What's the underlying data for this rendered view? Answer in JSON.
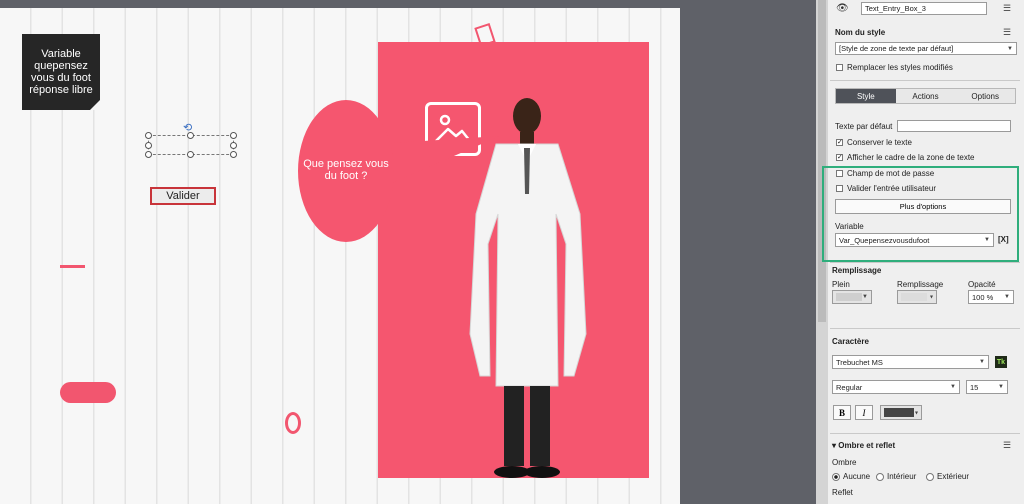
{
  "stage": {
    "note_text": "Variable quepensez vous du foot réponse libre",
    "validate_button": "Valider",
    "bubble_text": "Que pensez vous du foot ?"
  },
  "panel": {
    "object_name": "Text_Entry_Box_3",
    "style_name_label": "Nom du style",
    "style_name_value": "[Style de zone de texte par défaut]",
    "replace_styles_label": "Remplacer les styles modifiés",
    "tabs": [
      {
        "label": "Style",
        "active": true
      },
      {
        "label": "Actions",
        "active": false
      },
      {
        "label": "Options",
        "active": false
      }
    ],
    "default_text_label": "Texte par défaut",
    "default_text_value": "",
    "keep_text_label": "Conserver le texte",
    "keep_text_checked": true,
    "show_frame_label": "Afficher le cadre de la zone de texte",
    "show_frame_checked": true,
    "password_label": "Champ de mot de passe",
    "password_checked": false,
    "validate_input_label": "Valider l'entrée utilisateur",
    "validate_input_checked": false,
    "more_options_button": "Plus d'options",
    "variable_label": "Variable",
    "variable_value": "Var_Quepensezvousdufoot",
    "variable_button": "[X]",
    "fill_section": "Remplissage",
    "fill_plain_label": "Plein",
    "fill_label": "Remplissage",
    "opacity_label": "Opacité",
    "opacity_value": "100 %",
    "character_section": "Caractère",
    "font_value": "Trebuchet MS",
    "typekit_badge": "Tk",
    "font_style_value": "Regular",
    "font_size_value": "15",
    "bold_label": "B",
    "italic_label": "I",
    "shadow_section": "Ombre et reflet",
    "shadow_label": "Ombre",
    "shadow_options": [
      "Aucune",
      "Intérieur",
      "Extérieur"
    ],
    "shadow_selected": "Aucune",
    "reflection_label": "Reflet"
  },
  "colors": {
    "accent_pink": "#f5566f",
    "highlight_green": "#2fae7c",
    "validate_border": "#c8343a",
    "text_color_swatch": "#444444"
  }
}
